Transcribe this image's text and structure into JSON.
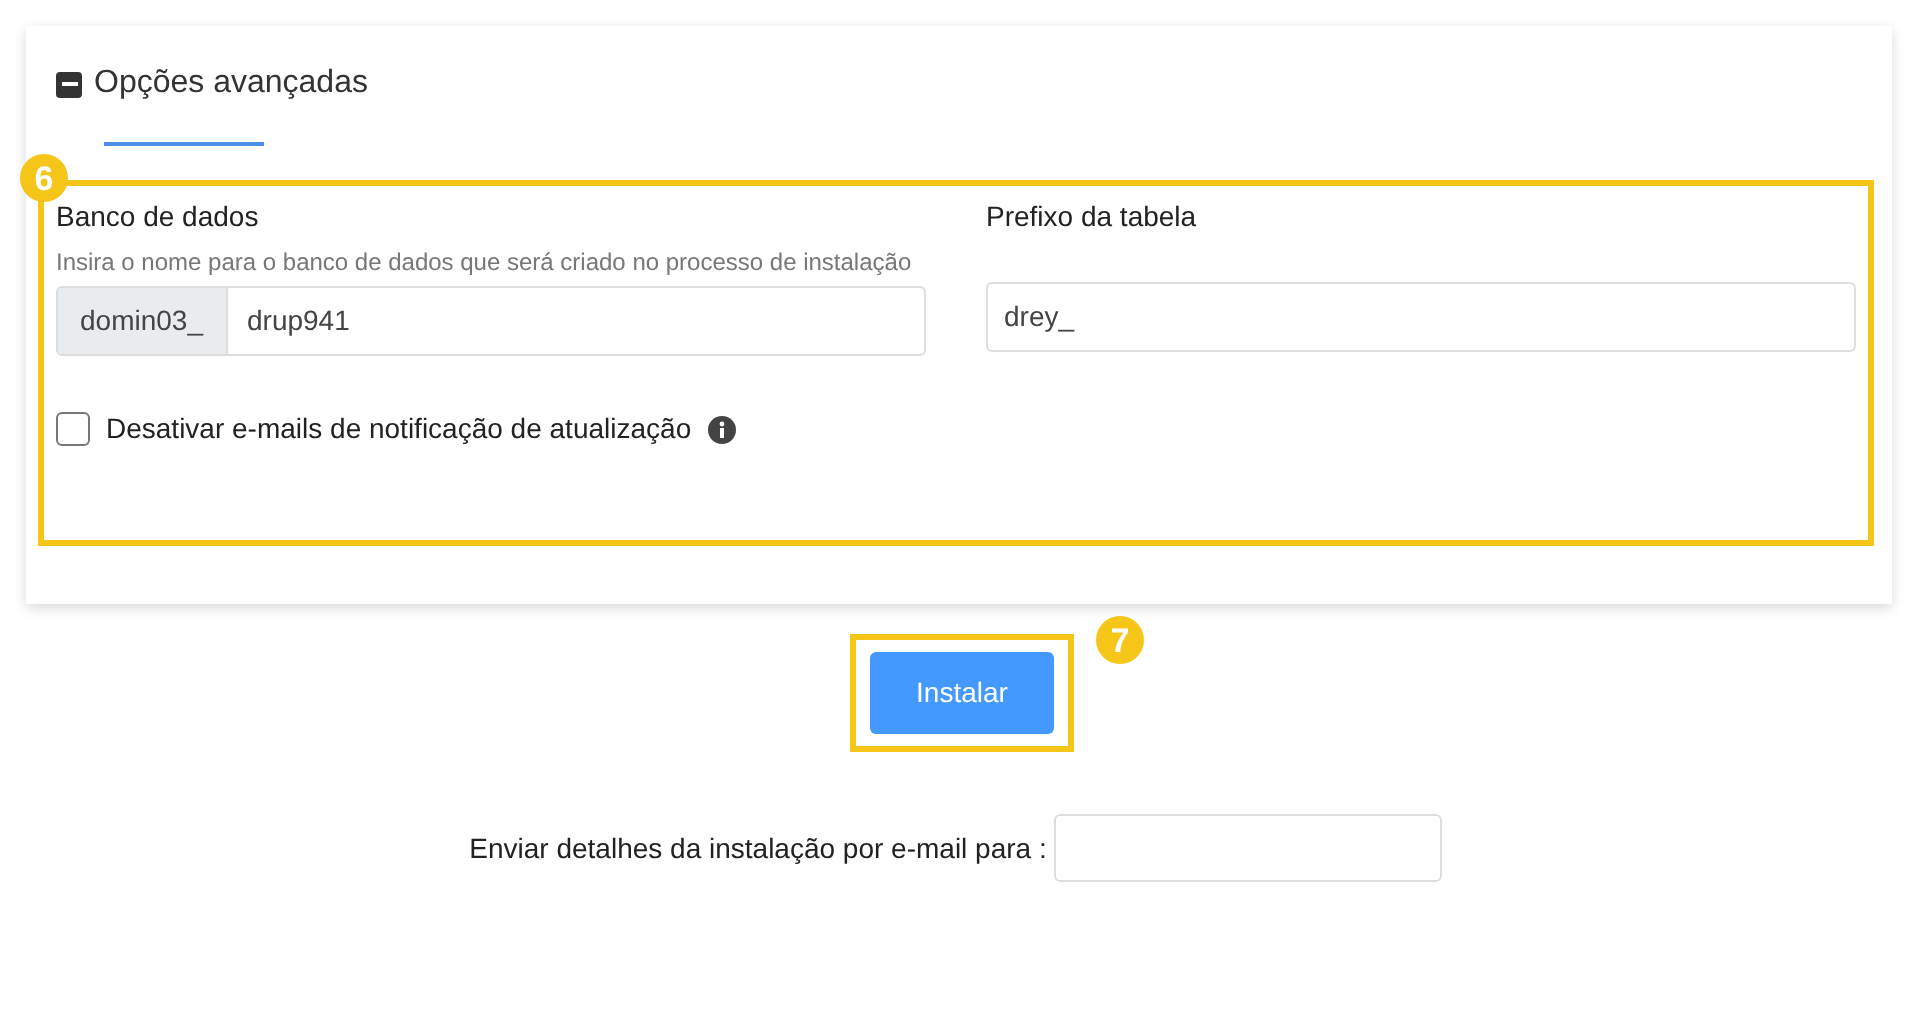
{
  "section": {
    "title": "Opções avançadas",
    "expanded": true
  },
  "callouts": [
    {
      "label": "6"
    },
    {
      "label": "7"
    }
  ],
  "database": {
    "label": "Banco de dados",
    "hint": "Insira o nome para o banco de dados que será criado no processo de instalação",
    "prefix": "domin03_",
    "value": "drup941"
  },
  "table_prefix": {
    "label": "Prefixo da tabela",
    "value": "drey_"
  },
  "disable_emails": {
    "label": "Desativar e-mails de notificação de atualização",
    "checked": false
  },
  "install_button": "Instalar",
  "email_details": {
    "label": "Enviar detalhes da instalação por e-mail para :"
  }
}
